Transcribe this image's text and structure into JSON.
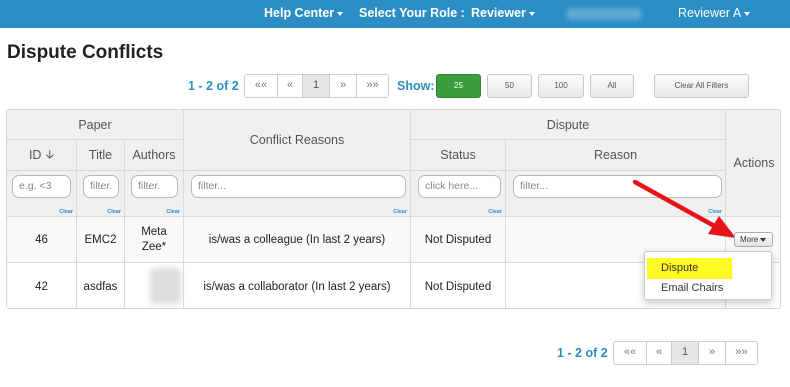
{
  "nav": {
    "help_center": "Help Center",
    "select_role": "Select Your Role :",
    "role": "Reviewer",
    "user": "Reviewer A"
  },
  "page": {
    "title": "Dispute Conflicts"
  },
  "pagination": {
    "info": "1 - 2 of 2",
    "first": "««",
    "prev": "«",
    "current": "1",
    "next": "»",
    "last": "»»"
  },
  "show": {
    "label": "Show:",
    "options": [
      "25",
      "50",
      "100",
      "All"
    ],
    "selected": "25",
    "clear_filters": "Clear All Filters"
  },
  "table": {
    "groups": {
      "paper": "Paper",
      "dispute": "Dispute"
    },
    "columns": {
      "id": "ID",
      "title": "Title",
      "authors": "Authors",
      "conflict_reasons": "Conflict Reasons",
      "status": "Status",
      "reason": "Reason",
      "actions": "Actions"
    },
    "filters": {
      "id_placeholder": "e.g. <3",
      "title_placeholder": "filter.",
      "authors_placeholder": "filter.",
      "conflict_placeholder": "filter...",
      "status_placeholder": "click here...",
      "reason_placeholder": "filter...",
      "clear": "Clear"
    },
    "rows": [
      {
        "id": "46",
        "title": "EMC2",
        "authors": "Meta Zee*",
        "conflict": "is/was a colleague (In last 2 years)",
        "status": "Not Disputed",
        "reason": ""
      },
      {
        "id": "42",
        "title": "asdfas",
        "authors": "",
        "conflict": "is/was a collaborator (In last 2 years)",
        "status": "Not Disputed",
        "reason": ""
      }
    ]
  },
  "actions": {
    "more_label": "More",
    "menu": [
      "Dispute",
      "Email Chairs"
    ]
  },
  "colors": {
    "nav_bg": "#2a8ec4",
    "accent": "#2a8ec4",
    "active_size": "#3c9d3c",
    "highlight": "#fffa24",
    "arrow": "#e8121b"
  }
}
